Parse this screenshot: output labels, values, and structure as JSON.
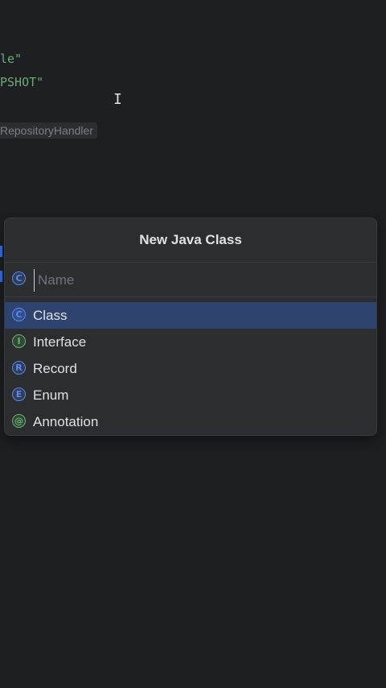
{
  "editor": {
    "line1": "le\"",
    "line2": "PSHOT\"",
    "hint": "RepositoryHandler"
  },
  "dialog": {
    "title": "New Java Class",
    "name_placeholder": "Name",
    "name_value": "",
    "items": [
      {
        "label": "Class",
        "icon": "class-icon",
        "glyph": "C",
        "selected": true
      },
      {
        "label": "Interface",
        "icon": "interface-icon",
        "glyph": "I",
        "selected": false
      },
      {
        "label": "Record",
        "icon": "record-icon",
        "glyph": "R",
        "selected": false
      },
      {
        "label": "Enum",
        "icon": "enum-icon",
        "glyph": "E",
        "selected": false
      },
      {
        "label": "Annotation",
        "icon": "annotation-icon",
        "glyph": "@",
        "selected": false
      }
    ]
  },
  "colors": {
    "background": "#1e1f22",
    "popup": "#2b2d30",
    "selection": "#2e436e",
    "string": "#6aab73",
    "accent_blue": "#548af7",
    "accent_green": "#5fb865"
  }
}
